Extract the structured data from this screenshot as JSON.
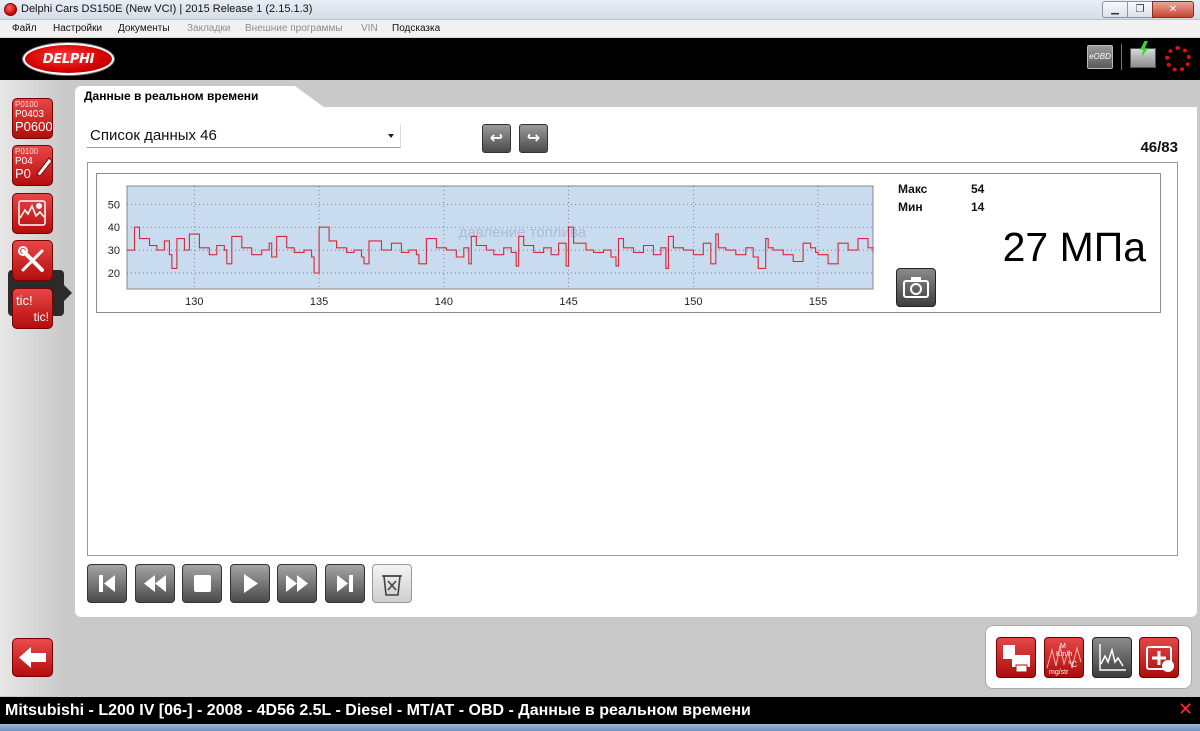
{
  "window": {
    "title": "Delphi Cars DS150E (New VCI) | 2015 Release 1 (2.15.1.3)",
    "min_glyph": "▁",
    "max_glyph": "❐",
    "close_glyph": "✕"
  },
  "menu": [
    {
      "label": "Файл",
      "enabled": true
    },
    {
      "label": "Настройки",
      "enabled": true
    },
    {
      "label": "Документы",
      "enabled": true
    },
    {
      "label": "Закладки",
      "enabled": false
    },
    {
      "label": "Внешние программы",
      "enabled": false
    },
    {
      "label": "VIN",
      "enabled": false
    },
    {
      "label": "Подсказка",
      "enabled": true
    }
  ],
  "header": {
    "logo_text": "DELPHI",
    "eobd_label": "eOBD",
    "icons": [
      "eobd-icon",
      "battery-icon",
      "connection-spinner-icon"
    ]
  },
  "sidebar": {
    "dtc_read": [
      "P0100",
      "P0403",
      "P0600"
    ],
    "dtc_clear": [
      "P0100",
      "P04",
      "P0"
    ],
    "tic": [
      "tic!",
      "tic!"
    ],
    "icons": [
      "dtc-read-icon",
      "dtc-clear-icon",
      "live-data-icon",
      "service-tools-icon",
      "actuator-test-icon",
      "back-arrow-icon"
    ],
    "accent": "#c81414"
  },
  "tab": {
    "label": "Данные в реальном времени"
  },
  "list": {
    "selected": "Список данных 46"
  },
  "nav": {
    "prev_glyph": "↩",
    "next_glyph": "↪"
  },
  "counter": "46/83",
  "stats": {
    "max_label": "Макс",
    "max_value": "54",
    "min_label": "Мин",
    "min_value": "14"
  },
  "current_value": "27 МПа",
  "chart_data": {
    "type": "line",
    "title": "давление топлива",
    "y_ticks": [
      "20",
      "30",
      "40",
      "50"
    ],
    "x_ticks": [
      "130",
      "135",
      "140",
      "145",
      "150",
      "155"
    ],
    "xlim": [
      127.3,
      157.2
    ],
    "ylim": [
      13,
      58
    ],
    "grid": true,
    "line_color": "#d42a3a",
    "plot_bg": "#c9dbee",
    "series": [
      {
        "x": [
          127.3,
          127.6,
          127.8,
          128.2,
          128.5,
          128.8,
          129.0,
          129.1,
          129.3,
          129.6,
          129.8,
          130.2,
          130.6,
          130.9,
          131.2,
          131.3,
          131.5,
          131.9,
          132.3,
          132.7,
          133.0,
          133.1,
          133.3,
          133.7,
          134.0,
          134.4,
          134.7,
          134.8,
          135.0,
          135.4,
          135.7,
          136.1,
          136.4,
          136.7,
          136.8,
          137.0,
          137.5,
          137.9,
          138.3,
          138.6,
          138.9,
          139.0,
          139.3,
          139.7,
          140.1,
          140.5,
          140.8,
          141.0,
          141.1,
          141.3,
          141.7,
          142.0,
          142.4,
          142.7,
          142.9,
          143.0,
          143.2,
          143.6,
          144.0,
          144.3,
          144.6,
          144.9,
          145.0,
          145.2,
          145.7,
          146.0,
          146.4,
          146.7,
          146.9,
          147.0,
          147.2,
          147.6,
          148.0,
          148.4,
          148.7,
          148.9,
          149.0,
          149.2,
          149.6,
          150.0,
          150.4,
          150.7,
          150.9,
          151.0,
          151.3,
          151.7,
          152.1,
          152.4,
          152.6,
          152.9,
          153.0,
          153.2,
          153.6,
          154.0,
          154.4,
          154.7,
          154.9,
          155.0,
          155.4,
          155.8,
          156.2,
          156.6,
          157.0,
          157.2
        ],
        "y": [
          30,
          40,
          35,
          32,
          30,
          34,
          28,
          22,
          35,
          30,
          37,
          31,
          28,
          32,
          30,
          24,
          36,
          31,
          28,
          30,
          33,
          27,
          36,
          31,
          29,
          30,
          27,
          20,
          40,
          34,
          31,
          29,
          30,
          27,
          24,
          34,
          30,
          33,
          29,
          30,
          28,
          24,
          35,
          31,
          30,
          27,
          31,
          24,
          36,
          32,
          30,
          28,
          31,
          29,
          23,
          36,
          32,
          29,
          31,
          28,
          33,
          23,
          40,
          33,
          30,
          29,
          30,
          27,
          23,
          35,
          31,
          29,
          32,
          28,
          31,
          22,
          36,
          31,
          30,
          28,
          33,
          24,
          37,
          31,
          30,
          28,
          31,
          27,
          22,
          35,
          31,
          30,
          28,
          25,
          33,
          31,
          29,
          28,
          24,
          33,
          30,
          35,
          31,
          29
        ]
      }
    ]
  },
  "playback": [
    "first-icon",
    "rewind-icon",
    "stop-icon",
    "play-icon",
    "fast-forward-icon",
    "last-icon",
    "clear-trash-icon"
  ],
  "tools": [
    "print-icon",
    "units-icon",
    "graph-mode-icon",
    "add-parameter-icon"
  ],
  "units_labels": [
    "M",
    "Km/h",
    "°C",
    "mg/str"
  ],
  "status": {
    "text": "Mitsubishi - L200 IV [06-] - 2008 - 4D56 2.5L - Diesel - MT/AT - OBD - Данные в реальном времени",
    "close_glyph": "✕"
  }
}
